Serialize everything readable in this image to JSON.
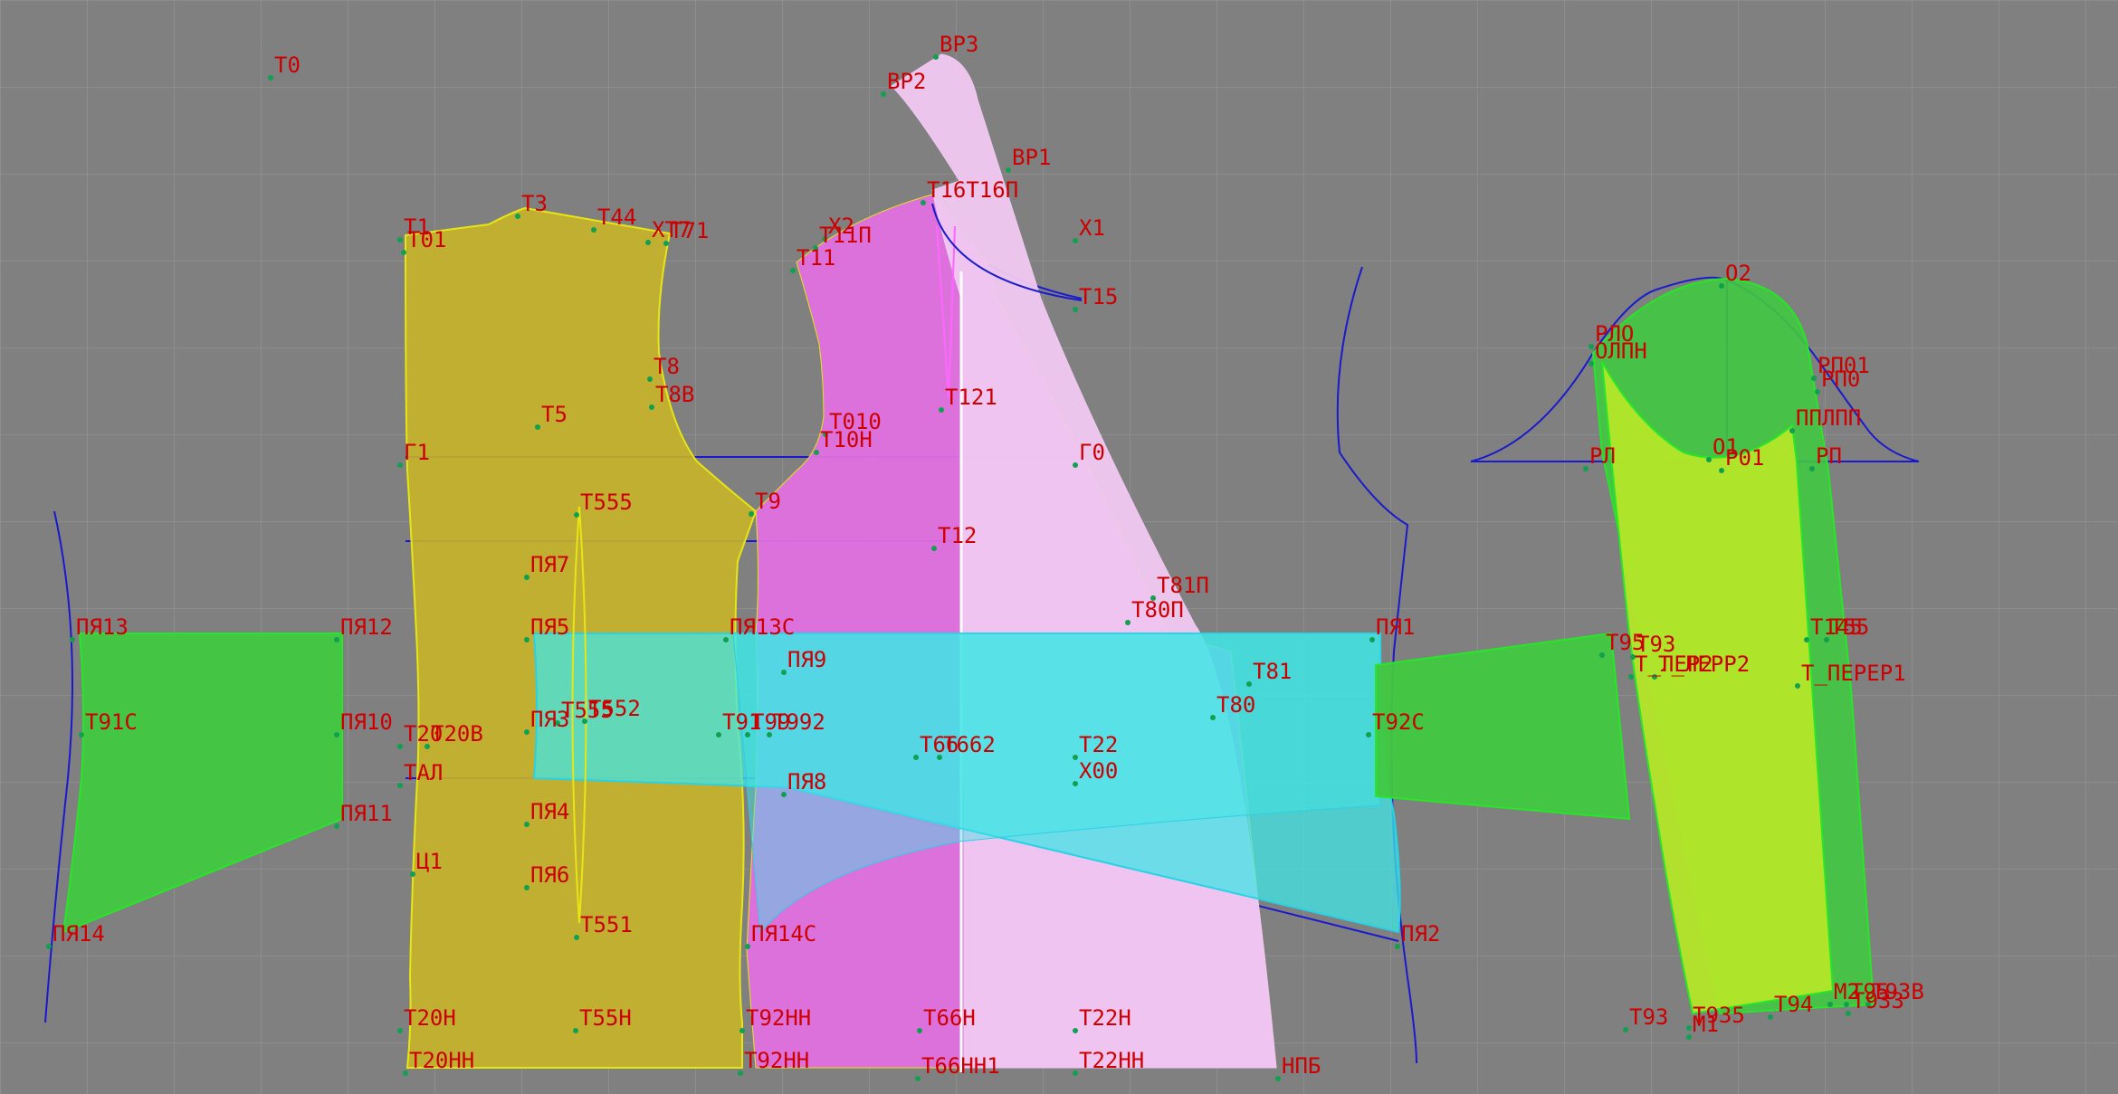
{
  "colors": {
    "background": "#808080",
    "grid": "#9a9a9a",
    "label": "#cc0000",
    "construction_line": "#1a1acc",
    "point": "#10a050",
    "piece_yellow": "#c8b428",
    "piece_magenta": "#e070e0",
    "piece_pink": "#f0c8f0",
    "piece_green": "#40c840",
    "piece_lime": "#b4e628",
    "piece_cyan": "#40e6e6",
    "outline_yellow": "#e6e614",
    "outline_green": "#28e628",
    "outline_cyan": "#28d2e6"
  },
  "pieces": [
    {
      "id": "back-panel",
      "color": "piece_yellow",
      "stroke": "outline_yellow"
    },
    {
      "id": "front-panel",
      "color": "piece_magenta",
      "stroke": "outline_yellow"
    },
    {
      "id": "front-extension",
      "color": "piece_pink",
      "stroke": "piece_pink"
    },
    {
      "id": "left-pocket",
      "color": "piece_green",
      "stroke": "outline_green"
    },
    {
      "id": "belt-cyan",
      "color": "piece_cyan",
      "stroke": "outline_cyan"
    },
    {
      "id": "side-strap",
      "color": "piece_green",
      "stroke": "outline_green"
    },
    {
      "id": "sleeve-cap",
      "color": "piece_green",
      "stroke": "outline_green"
    },
    {
      "id": "sleeve-lower",
      "color": "piece_lime",
      "stroke": "outline_green"
    }
  ],
  "labels": [
    {
      "id": "T0",
      "text": "Т0"
    },
    {
      "id": "BP3",
      "text": "ВР3"
    },
    {
      "id": "BP2",
      "text": "ВР2"
    },
    {
      "id": "BP1",
      "text": "ВР1"
    },
    {
      "id": "T16",
      "text": "Т16Т16П"
    },
    {
      "id": "X1",
      "text": "Х1"
    },
    {
      "id": "X2",
      "text": "Х2"
    },
    {
      "id": "T11P",
      "text": "Т11П"
    },
    {
      "id": "T11",
      "text": "Т11"
    },
    {
      "id": "T15",
      "text": "Т15"
    },
    {
      "id": "T1",
      "text": "Т1"
    },
    {
      "id": "T01",
      "text": "Т01"
    },
    {
      "id": "T3",
      "text": "Т3"
    },
    {
      "id": "T44",
      "text": "Т44"
    },
    {
      "id": "XT7",
      "text": "ХТ7"
    },
    {
      "id": "T71",
      "text": "Т71"
    },
    {
      "id": "T8",
      "text": "Т8"
    },
    {
      "id": "T8B",
      "text": "Т8В"
    },
    {
      "id": "T5",
      "text": "Т5"
    },
    {
      "id": "T121",
      "text": "Т121"
    },
    {
      "id": "T010",
      "text": "Т010"
    },
    {
      "id": "T10H",
      "text": "Т10Н"
    },
    {
      "id": "G1",
      "text": "Г1"
    },
    {
      "id": "G0",
      "text": "Г0"
    },
    {
      "id": "T555",
      "text": "Т555"
    },
    {
      "id": "T9",
      "text": "Т9"
    },
    {
      "id": "T12",
      "text": "Т12"
    },
    {
      "id": "T81P",
      "text": "Т81П"
    },
    {
      "id": "T80P",
      "text": "Т80П"
    },
    {
      "id": "PYa7",
      "text": "ПЯ7"
    },
    {
      "id": "PYa13",
      "text": "ПЯ13"
    },
    {
      "id": "PYa12",
      "text": "ПЯ12"
    },
    {
      "id": "PYa5",
      "text": "ПЯ5"
    },
    {
      "id": "PYa13C",
      "text": "ПЯ13С"
    },
    {
      "id": "PYa1",
      "text": "ПЯ1"
    },
    {
      "id": "PYa9",
      "text": "ПЯ9"
    },
    {
      "id": "T81",
      "text": "Т81"
    },
    {
      "id": "T80",
      "text": "Т80"
    },
    {
      "id": "T91C",
      "text": "Т91С"
    },
    {
      "id": "PYa10",
      "text": "ПЯ10"
    },
    {
      "id": "T20",
      "text": "Т20"
    },
    {
      "id": "T20B",
      "text": "Т20В"
    },
    {
      "id": "PYa3",
      "text": "ПЯ3"
    },
    {
      "id": "T555b",
      "text": "Т555"
    },
    {
      "id": "T552",
      "text": "Т552"
    },
    {
      "id": "T91",
      "text": "Т91"
    },
    {
      "id": "T99",
      "text": "Т99"
    },
    {
      "id": "T992",
      "text": "Т992"
    },
    {
      "id": "T66",
      "text": "Т66"
    },
    {
      "id": "T662",
      "text": "Т662"
    },
    {
      "id": "T22",
      "text": "Т22"
    },
    {
      "id": "T92C",
      "text": "Т92С"
    },
    {
      "id": "TAL",
      "text": "ТАЛ"
    },
    {
      "id": "PYa8",
      "text": "ПЯ8"
    },
    {
      "id": "X00",
      "text": "Х00"
    },
    {
      "id": "PYa11",
      "text": "ПЯ11"
    },
    {
      "id": "PYa4",
      "text": "ПЯ4"
    },
    {
      "id": "C1",
      "text": "Ц1"
    },
    {
      "id": "PYa6",
      "text": "ПЯ6"
    },
    {
      "id": "PYa14",
      "text": "ПЯ14"
    },
    {
      "id": "T551",
      "text": "Т551"
    },
    {
      "id": "PYa14C",
      "text": "ПЯ14С"
    },
    {
      "id": "PYa2",
      "text": "ПЯ2"
    },
    {
      "id": "T20N",
      "text": "Т20Н"
    },
    {
      "id": "T55N",
      "text": "Т55Н"
    },
    {
      "id": "T92N",
      "text": "Т92НН"
    },
    {
      "id": "T66N",
      "text": "Т66Н"
    },
    {
      "id": "T22N",
      "text": "Т22Н"
    },
    {
      "id": "T20NN",
      "text": "Т20НН"
    },
    {
      "id": "T92NN",
      "text": "Т92НН"
    },
    {
      "id": "T66NN",
      "text": "Т66НН1"
    },
    {
      "id": "T22NN",
      "text": "Т22НН"
    },
    {
      "id": "NPB",
      "text": "НПБ"
    },
    {
      "id": "O2",
      "text": "О2"
    },
    {
      "id": "RLO",
      "text": "РЛО"
    },
    {
      "id": "OPLN",
      "text": "ОЛПН"
    },
    {
      "id": "RPO1",
      "text": "РП01"
    },
    {
      "id": "RPO",
      "text": "РП0"
    },
    {
      "id": "PPL",
      "text": "ППЛПП"
    },
    {
      "id": "RL",
      "text": "РЛ"
    },
    {
      "id": "O1",
      "text": "О1"
    },
    {
      "id": "P01",
      "text": "Р01"
    },
    {
      "id": "RP",
      "text": "РП"
    },
    {
      "id": "T95",
      "text": "Т95"
    },
    {
      "id": "T93L",
      "text": "Т93"
    },
    {
      "id": "TLPER2",
      "text": "Т_ЛЕР2"
    },
    {
      "id": "TLPER2b",
      "text": "Т_ЛЕРР2"
    },
    {
      "id": "T145",
      "text": "Т145"
    },
    {
      "id": "T55",
      "text": "Т55"
    },
    {
      "id": "TPER1",
      "text": "Т_ПЕРЕР1"
    },
    {
      "id": "T93",
      "text": "Т93"
    },
    {
      "id": "T935",
      "text": "Т935"
    },
    {
      "id": "T94",
      "text": "Т94"
    },
    {
      "id": "M2",
      "text": "М2"
    },
    {
      "id": "T95b",
      "text": "Т95"
    },
    {
      "id": "T93B",
      "text": "Т93В"
    },
    {
      "id": "M1",
      "text": "М1"
    },
    {
      "id": "T933",
      "text": "Т933"
    }
  ]
}
